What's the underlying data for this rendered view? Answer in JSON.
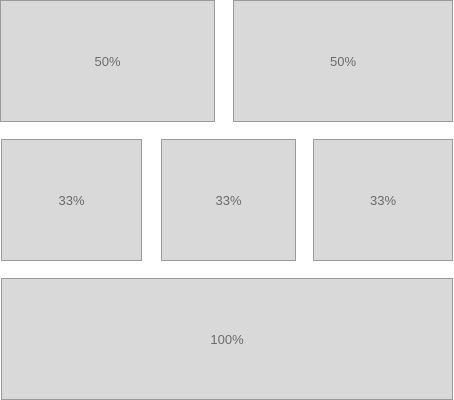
{
  "grid": {
    "rows": [
      {
        "cells": [
          {
            "label": "50%"
          },
          {
            "label": "50%"
          }
        ]
      },
      {
        "cells": [
          {
            "label": "33%"
          },
          {
            "label": "33%"
          },
          {
            "label": "33%"
          }
        ]
      },
      {
        "cells": [
          {
            "label": "100%"
          }
        ]
      }
    ]
  },
  "colors": {
    "box_fill": "#d9d9d9",
    "box_border": "#9a9a9a",
    "label_text": "#6b6b6b",
    "background": "#ffffff"
  }
}
